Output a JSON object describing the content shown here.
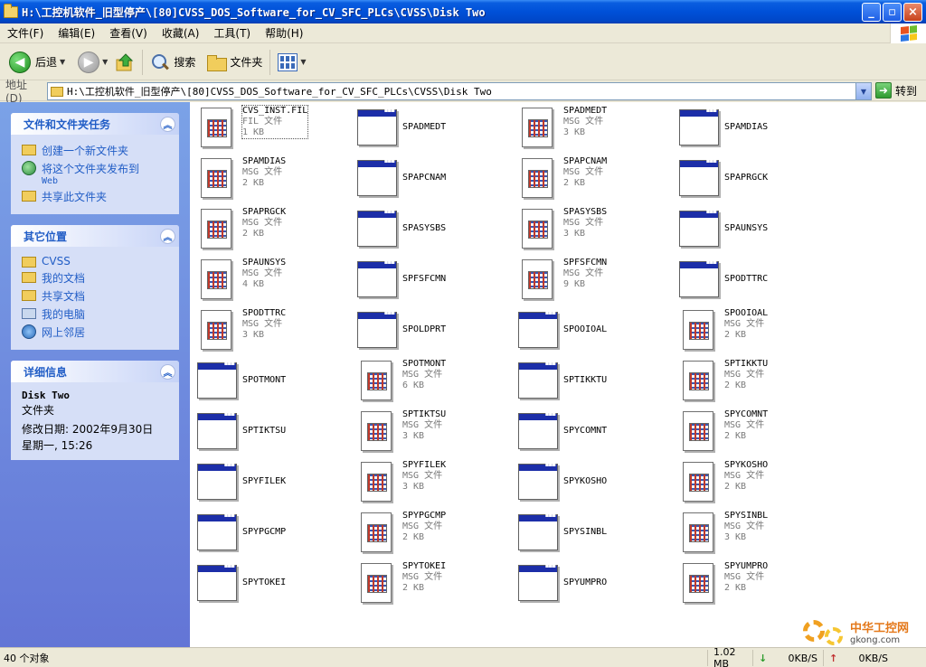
{
  "window": {
    "title": "H:\\工控机软件_旧型停产\\[80]CVSS_DOS_Software_for_CV_SFC_PLCs\\CVSS\\Disk Two",
    "minimize": "_",
    "maximize": "▫",
    "close": "×"
  },
  "menu": [
    "文件(F)",
    "编辑(E)",
    "查看(V)",
    "收藏(A)",
    "工具(T)",
    "帮助(H)"
  ],
  "toolbar": {
    "back": "后退",
    "search": "搜索",
    "folders": "文件夹"
  },
  "address": {
    "label": "地址(D)",
    "value": "H:\\工控机软件_旧型停产\\[80]CVSS_DOS_Software_for_CV_SFC_PLCs\\CVSS\\Disk Two",
    "go": "转到"
  },
  "tasks": {
    "title": "文件和文件夹任务",
    "items": [
      {
        "label": "创建一个新文件夹",
        "icon": "new-folder-icon"
      },
      {
        "label": "将这个文件夹发布到",
        "sub": "Web",
        "icon": "publish-web-icon"
      },
      {
        "label": "共享此文件夹",
        "icon": "share-folder-icon"
      }
    ]
  },
  "places": {
    "title": "其它位置",
    "items": [
      {
        "label": "CVSS",
        "icon": "folder-icon"
      },
      {
        "label": "我的文档",
        "icon": "my-documents-icon"
      },
      {
        "label": "共享文档",
        "icon": "shared-documents-icon"
      },
      {
        "label": "我的电脑",
        "icon": "my-computer-icon"
      },
      {
        "label": "网上邻居",
        "icon": "network-icon"
      }
    ]
  },
  "details": {
    "title": "详细信息",
    "name": "Disk Two",
    "type": "文件夹",
    "modified_label": "修改日期: 2002年9月30日",
    "modified_time": "星期一, 15:26"
  },
  "files": [
    {
      "name": "CVS_INST.FIL",
      "type": "FIL 文件",
      "size": "1 KB",
      "kind": "doc"
    },
    {
      "name": "SPADMEDT",
      "kind": "app"
    },
    {
      "name": "SPADMEDT",
      "type": "MSG 文件",
      "size": "3 KB",
      "kind": "doc"
    },
    {
      "name": "SPAMDIAS",
      "kind": "app"
    },
    {
      "name": "SPAMDIAS",
      "type": "MSG 文件",
      "size": "2 KB",
      "kind": "doc"
    },
    {
      "name": "SPAPCNAM",
      "kind": "app"
    },
    {
      "name": "SPAPCNAM",
      "type": "MSG 文件",
      "size": "2 KB",
      "kind": "doc"
    },
    {
      "name": "SPAPRGCK",
      "kind": "app"
    },
    {
      "name": "SPAPRGCK",
      "type": "MSG 文件",
      "size": "2 KB",
      "kind": "doc"
    },
    {
      "name": "SPASYSBS",
      "kind": "app"
    },
    {
      "name": "SPASYSBS",
      "type": "MSG 文件",
      "size": "3 KB",
      "kind": "doc"
    },
    {
      "name": "SPAUNSYS",
      "kind": "app"
    },
    {
      "name": "SPAUNSYS",
      "type": "MSG 文件",
      "size": "4 KB",
      "kind": "doc"
    },
    {
      "name": "SPFSFCMN",
      "kind": "app"
    },
    {
      "name": "SPFSFCMN",
      "type": "MSG 文件",
      "size": "9 KB",
      "kind": "doc"
    },
    {
      "name": "SPODTTRC",
      "kind": "app"
    },
    {
      "name": "SPODTTRC",
      "type": "MSG 文件",
      "size": "3 KB",
      "kind": "doc"
    },
    {
      "name": "SPOLDPRT",
      "kind": "app"
    },
    {
      "name": "SPOOIOAL",
      "kind": "app"
    },
    {
      "name": "SPOOIOAL",
      "type": "MSG 文件",
      "size": "2 KB",
      "kind": "doc"
    },
    {
      "name": "SPOTMONT",
      "kind": "app"
    },
    {
      "name": "SPOTMONT",
      "type": "MSG 文件",
      "size": "6 KB",
      "kind": "doc"
    },
    {
      "name": "SPTIKKTU",
      "kind": "app"
    },
    {
      "name": "SPTIKKTU",
      "type": "MSG 文件",
      "size": "2 KB",
      "kind": "doc"
    },
    {
      "name": "SPTIKTSU",
      "kind": "app"
    },
    {
      "name": "SPTIKTSU",
      "type": "MSG 文件",
      "size": "3 KB",
      "kind": "doc"
    },
    {
      "name": "SPYCOMNT",
      "kind": "app"
    },
    {
      "name": "SPYCOMNT",
      "type": "MSG 文件",
      "size": "2 KB",
      "kind": "doc"
    },
    {
      "name": "SPYFILEK",
      "kind": "app"
    },
    {
      "name": "SPYFILEK",
      "type": "MSG 文件",
      "size": "3 KB",
      "kind": "doc"
    },
    {
      "name": "SPYKOSHO",
      "kind": "app"
    },
    {
      "name": "SPYKOSHO",
      "type": "MSG 文件",
      "size": "2 KB",
      "kind": "doc"
    },
    {
      "name": "SPYPGCMP",
      "kind": "app"
    },
    {
      "name": "SPYPGCMP",
      "type": "MSG 文件",
      "size": "2 KB",
      "kind": "doc"
    },
    {
      "name": "SPYSINBL",
      "kind": "app"
    },
    {
      "name": "SPYSINBL",
      "type": "MSG 文件",
      "size": "3 KB",
      "kind": "doc"
    },
    {
      "name": "SPYTOKEI",
      "kind": "app"
    },
    {
      "name": "SPYTOKEI",
      "type": "MSG 文件",
      "size": "2 KB",
      "kind": "doc"
    },
    {
      "name": "SPYUMPRO",
      "kind": "app"
    },
    {
      "name": "SPYUMPRO",
      "type": "MSG 文件",
      "size": "2 KB",
      "kind": "doc"
    }
  ],
  "status": {
    "count": "40 个对象",
    "size": "1.02 MB",
    "down": "0KB/S",
    "up": "0KB/S"
  },
  "watermark": {
    "text": "中华工控网",
    "url": "gkong.com"
  },
  "colors": {
    "titlebar": "#0050d8",
    "taskpane": "#7ba2e7",
    "link": "#215dc6"
  }
}
